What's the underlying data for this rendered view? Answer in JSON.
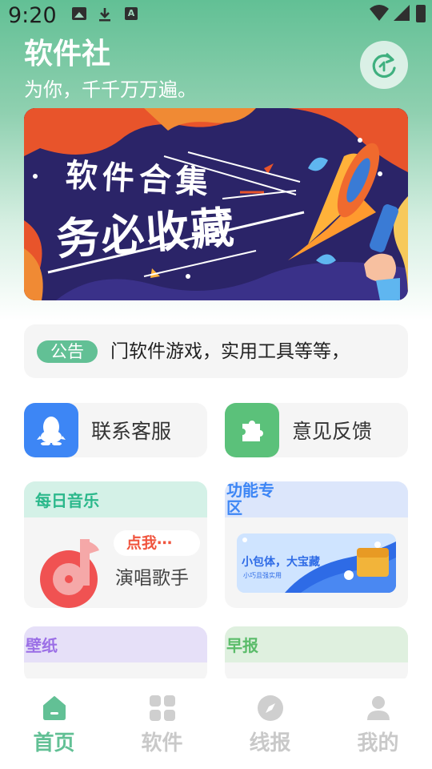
{
  "status_bar": {
    "time": "9:20",
    "a_icon_label": "A"
  },
  "header": {
    "title": "软件社",
    "subtitle": "为你，千千万万遍。"
  },
  "banner": {
    "line1": "软件合集",
    "line2": "务必收藏"
  },
  "notice": {
    "badge": "公告",
    "text": "门软件游戏，实用工具等等，"
  },
  "actions": [
    {
      "label": "联系客服",
      "icon": "qq-penguin-icon",
      "color": "#3d86f5"
    },
    {
      "label": "意见反馈",
      "icon": "puzzle-icon",
      "color": "#5bc17a"
    }
  ],
  "cards": {
    "music": {
      "title": "每日音乐",
      "bubble": "点我⋯",
      "label": "演唱歌手",
      "head_color": "#d4f1e7",
      "title_color": "#2bb88b"
    },
    "features": {
      "title": "功能专区",
      "promo_main": "小包体，大宝藏",
      "promo_sub": "小巧且强实用",
      "head_color": "#dce6fb",
      "title_color": "#3d86f5"
    },
    "wallpaper": {
      "title": "壁纸",
      "head_color": "#e6e0f8",
      "title_color": "#9b6fe6"
    },
    "news": {
      "title": "早报",
      "head_color": "#dff0df",
      "title_color": "#5bbc6a"
    }
  },
  "bottom_nav": [
    {
      "label": "首页",
      "icon": "home-icon",
      "active": true
    },
    {
      "label": "软件",
      "icon": "apps-grid-icon",
      "active": false
    },
    {
      "label": "线报",
      "icon": "compass-icon",
      "active": false
    },
    {
      "label": "我的",
      "icon": "profile-icon",
      "active": false
    }
  ],
  "colors": {
    "accent": "#62c095",
    "inactive": "#c9c9c9",
    "card_bg": "#f5f5f5"
  }
}
